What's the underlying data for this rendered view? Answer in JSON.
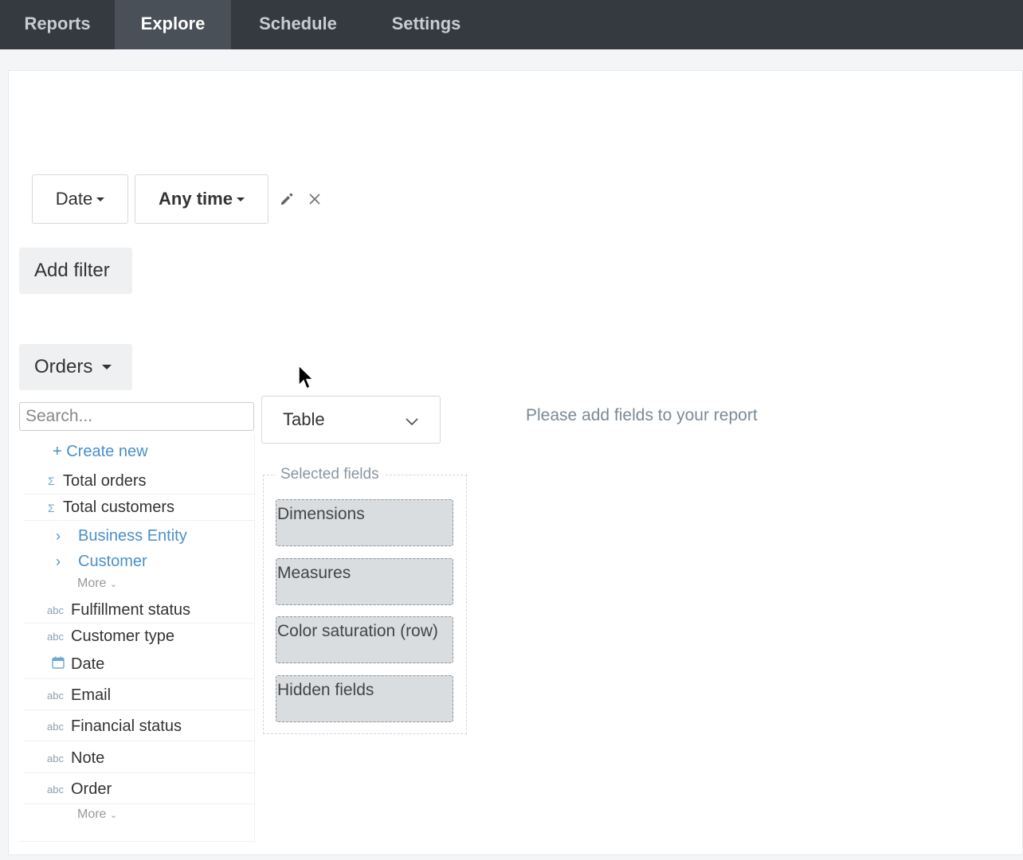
{
  "nav": {
    "tabs": [
      {
        "label": "Reports"
      },
      {
        "label": "Explore"
      },
      {
        "label": "Schedule"
      },
      {
        "label": "Settings"
      }
    ]
  },
  "filter": {
    "field_label": "Date",
    "range_label": "Any time",
    "edit_icon": "pencil-icon",
    "remove_icon": "close-icon"
  },
  "add_filter_label": "Add filter",
  "dataset": {
    "label": "Orders"
  },
  "search": {
    "placeholder": "Search..."
  },
  "fields": {
    "create_new": "+ Create new",
    "measures": [
      {
        "icon": "Σ",
        "label": "Total orders"
      },
      {
        "icon": "Σ",
        "label": "Total customers"
      }
    ],
    "groups": [
      {
        "label": "Business Entity"
      },
      {
        "label": "Customer"
      }
    ],
    "more_label": "More",
    "dimensions": [
      {
        "icon": "abc",
        "label": "Fulfillment status"
      },
      {
        "icon": "abc",
        "label": "Customer type"
      },
      {
        "icon": "calendar-icon",
        "label": "Date"
      },
      {
        "icon": "abc",
        "label": "Email"
      },
      {
        "icon": "abc",
        "label": "Financial status"
      },
      {
        "icon": "abc",
        "label": "Note"
      },
      {
        "icon": "abc",
        "label": "Order"
      }
    ]
  },
  "visualization": {
    "selected": "Table"
  },
  "selected_fields": {
    "title": "Selected fields",
    "zones": [
      {
        "label": "Dimensions"
      },
      {
        "label": "Measures"
      },
      {
        "label": "Color saturation (row)"
      },
      {
        "label": "Hidden fields"
      }
    ]
  },
  "empty_message": "Please add fields to your report",
  "colors": {
    "nav_bg": "#353a40",
    "nav_active": "#4a5058",
    "link": "#4a90c8",
    "dropzone_bg": "#d9dde0"
  }
}
